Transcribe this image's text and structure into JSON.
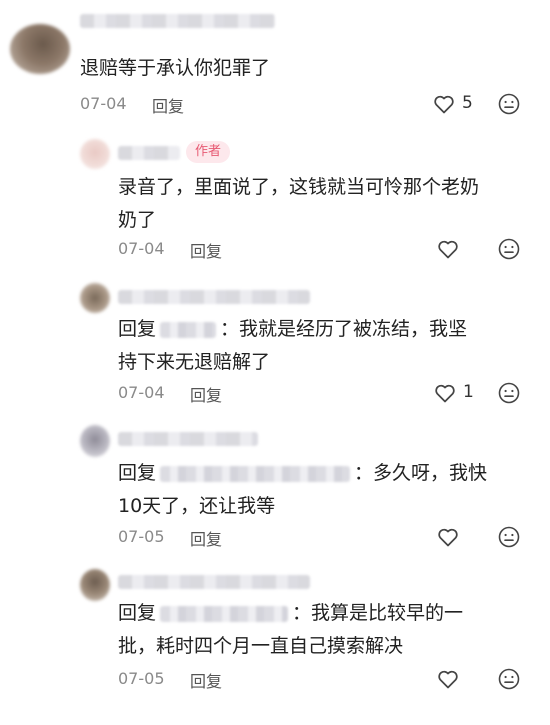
{
  "comments": [
    {
      "text": "退赔等于承认你犯罪了",
      "date": "07-04",
      "reply_label": "回复",
      "likes": "5"
    },
    {
      "badge": "作者",
      "text_line1": "录音了，里面说了，这钱就当可怜那个老奶",
      "text_line2": "奶了",
      "date": "07-04",
      "reply_label": "回复",
      "likes": ""
    },
    {
      "reply_prefix": "回复",
      "text_line1": "：我就是经历了被冻结，我坚",
      "text_line2": "持下来无退赔解了",
      "date": "07-04",
      "reply_label": "回复",
      "likes": "1"
    },
    {
      "reply_prefix": "回复",
      "text_line1": "：多久呀，我快",
      "text_line2": "10天了，还让我等",
      "date": "07-05",
      "reply_label": "回复",
      "likes": ""
    },
    {
      "reply_prefix": "回复",
      "text_line1": "：我算是比较早的一",
      "text_line2": "批，耗时四个月一直自己摸索解决",
      "date": "07-05",
      "reply_label": "回复",
      "likes": ""
    }
  ],
  "icons": {
    "like": "heart-outline-icon",
    "more": "meh-face-icon"
  }
}
